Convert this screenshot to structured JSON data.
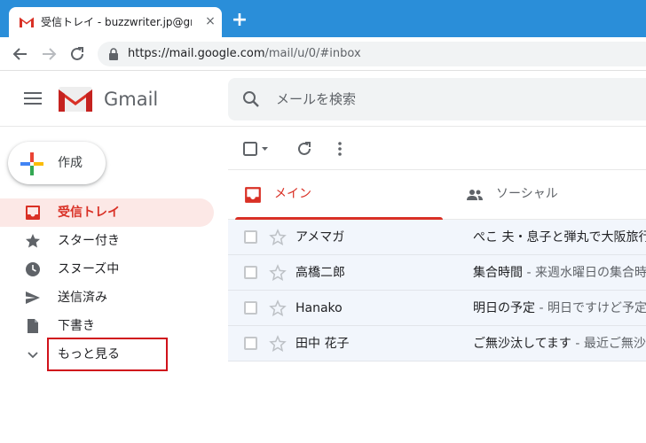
{
  "browser": {
    "tab_title": "受信トレイ - buzzwriter.jp@gmail.com",
    "tab_close": "×",
    "new_tab": "+",
    "url_host": "https://mail.google.com",
    "url_path": "/mail/u/0/#inbox"
  },
  "header": {
    "brand": "Gmail",
    "search_placeholder": "メールを検索"
  },
  "compose": {
    "label": "作成"
  },
  "sidebar": {
    "items": [
      {
        "label": "受信トレイ",
        "icon": "inbox-icon",
        "active": true
      },
      {
        "label": "スター付き",
        "icon": "star-icon",
        "active": false
      },
      {
        "label": "スヌーズ中",
        "icon": "clock-icon",
        "active": false
      },
      {
        "label": "送信済み",
        "icon": "send-icon",
        "active": false
      },
      {
        "label": "下書き",
        "icon": "draft-icon",
        "active": false
      },
      {
        "label": "もっと見る",
        "icon": "chevron-down-icon",
        "active": false
      }
    ]
  },
  "categories": [
    {
      "label": "メイン",
      "icon": "inbox-icon",
      "active": true
    },
    {
      "label": "ソーシャル",
      "icon": "people-icon",
      "active": false
    }
  ],
  "mails": [
    {
      "sender": "アメマガ",
      "subject": "ぺこ 夫・息子と弾丸で大阪旅行",
      "snippet": ""
    },
    {
      "sender": "高橋二郎",
      "subject": "集合時間",
      "snippet": " - 来週水曜日の集合時間"
    },
    {
      "sender": "Hanako",
      "subject": "明日の予定",
      "snippet": " - 明日ですけど予定"
    },
    {
      "sender": "田中 花子",
      "subject": "ご無沙汰してます",
      "snippet": " - 最近ご無沙汰"
    }
  ],
  "colors": {
    "tabstrip": "#2a8ed9",
    "accent_red": "#d93025",
    "highlight_box": "#d0121b"
  }
}
